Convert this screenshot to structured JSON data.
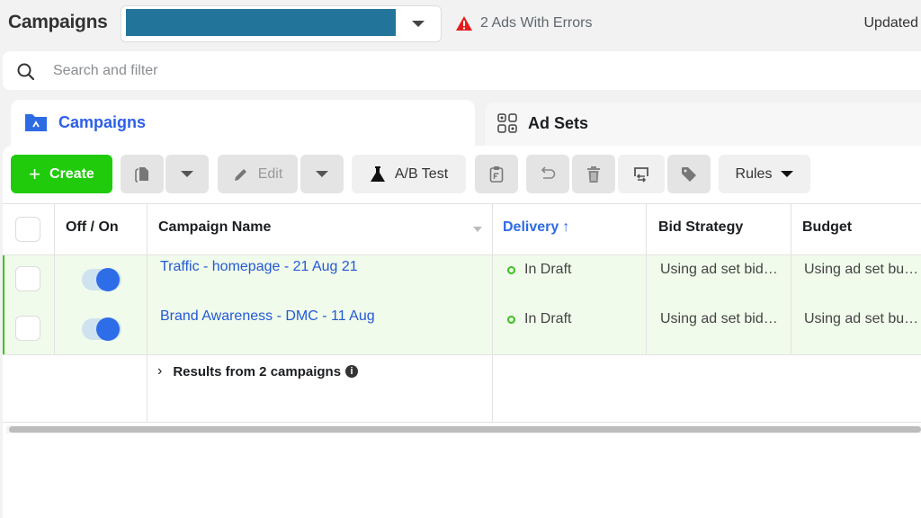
{
  "header": {
    "title": "Campaigns",
    "account_selector": {
      "value": "",
      "redacted": true,
      "redaction_color": "#23749b"
    },
    "errors_label": "2 Ads With Errors",
    "updated_label": "Updated"
  },
  "search": {
    "placeholder": "Search and filter",
    "value": ""
  },
  "tabs": [
    {
      "label": "Campaigns",
      "active": true,
      "icon": "folder-icon"
    },
    {
      "label": "Ad Sets",
      "active": false,
      "icon": "grid-icon"
    }
  ],
  "toolbar": {
    "create_label": "Create",
    "duplicate_icon": "duplicate-icon",
    "edit_label": "Edit",
    "ab_test_label": "A/B Test",
    "rules_label": "Rules",
    "icons": [
      "clipboard-icon",
      "undo-icon",
      "trash-icon",
      "swap-icon",
      "tag-icon"
    ]
  },
  "table": {
    "columns": [
      "Off / On",
      "Campaign Name",
      "Delivery",
      "Bid Strategy",
      "Budget"
    ],
    "sort_column": "Delivery",
    "sort_direction": "ascending",
    "rows": [
      {
        "on": true,
        "name": "Traffic - homepage - 21 Aug 21",
        "delivery": "In Draft",
        "bid_strategy": "Using ad set bid…",
        "budget": "Using ad set bu…"
      },
      {
        "on": true,
        "name": "Brand Awareness - DMC - 11 Aug",
        "delivery": "In Draft",
        "bid_strategy": "Using ad set bid…",
        "budget": "Using ad set bu…"
      }
    ],
    "summary_label": "Results from 2 campaigns"
  },
  "colors": {
    "accent_blue": "#2d6be4",
    "create_green": "#1fcb0b",
    "draft_green": "#3ac11e",
    "error_red": "#e41e1e",
    "row_highlight": "#f0fbeb"
  }
}
